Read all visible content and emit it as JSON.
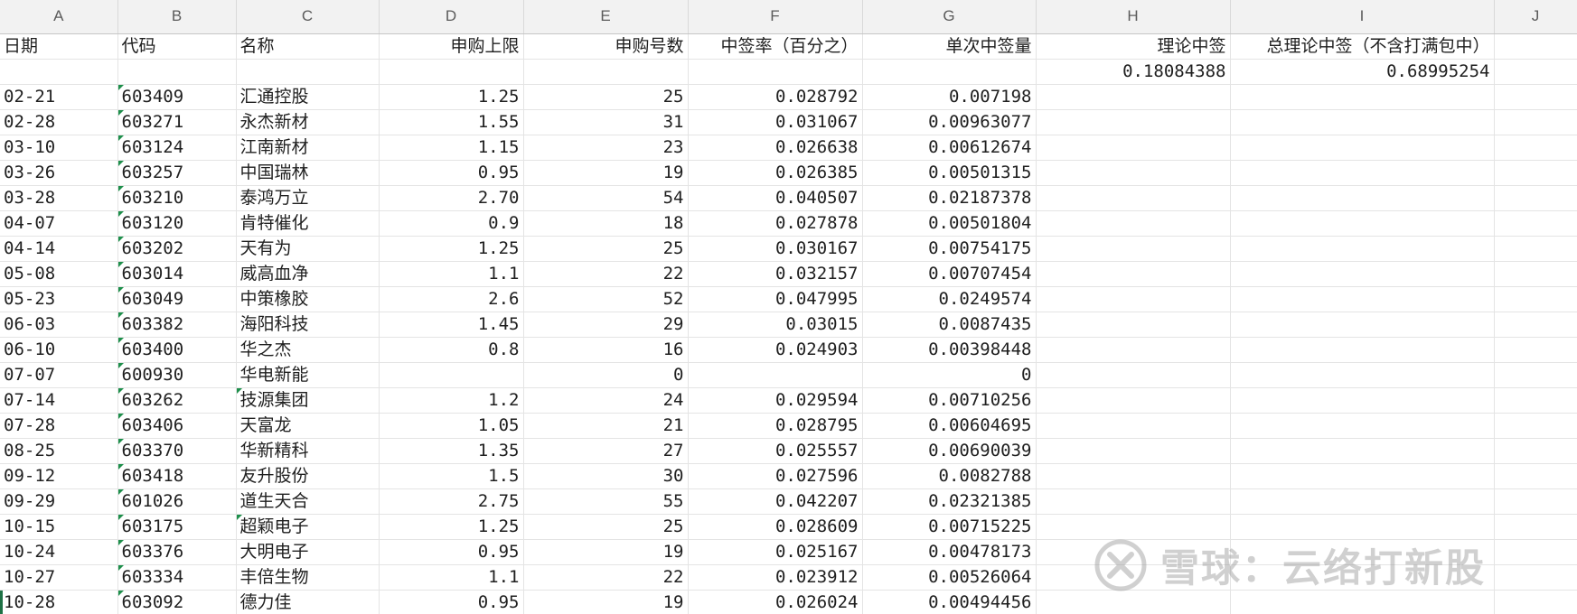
{
  "sheet": {
    "column_letters": [
      "A",
      "B",
      "C",
      "D",
      "E",
      "F",
      "G",
      "H",
      "I",
      "J"
    ],
    "headers": [
      "日期",
      "代码",
      "名称",
      "申购上限",
      "申购号数",
      "中签率（百分之）",
      "单次中签量",
      "理论中签",
      "总理论中签（不含打满包中）",
      ""
    ],
    "summary_row": [
      "",
      "",
      "",
      "",
      "",
      "",
      "",
      "0.18084388",
      "0.68995254",
      ""
    ],
    "rows": [
      [
        "02-21",
        "603409",
        "汇通控股",
        "1.25",
        "25",
        "0.028792",
        "0.007198",
        "",
        "",
        ""
      ],
      [
        "02-28",
        "603271",
        "永杰新材",
        "1.55",
        "31",
        "0.031067",
        "0.00963077",
        "",
        "",
        ""
      ],
      [
        "03-10",
        "603124",
        "江南新材",
        "1.15",
        "23",
        "0.026638",
        "0.00612674",
        "",
        "",
        ""
      ],
      [
        "03-26",
        "603257",
        "中国瑞林",
        "0.95",
        "19",
        "0.026385",
        "0.00501315",
        "",
        "",
        ""
      ],
      [
        "03-28",
        "603210",
        "泰鸿万立",
        "2.70",
        "54",
        "0.040507",
        "0.02187378",
        "",
        "",
        ""
      ],
      [
        "04-07",
        "603120",
        "肯特催化",
        "0.9",
        "18",
        "0.027878",
        "0.00501804",
        "",
        "",
        ""
      ],
      [
        "04-14",
        "603202",
        "天有为",
        "1.25",
        "25",
        "0.030167",
        "0.00754175",
        "",
        "",
        ""
      ],
      [
        "05-08",
        "603014",
        "威高血净",
        "1.1",
        "22",
        "0.032157",
        "0.00707454",
        "",
        "",
        ""
      ],
      [
        "05-23",
        "603049",
        "中策橡胶",
        "2.6",
        "52",
        "0.047995",
        "0.0249574",
        "",
        "",
        ""
      ],
      [
        "06-03",
        "603382",
        "海阳科技",
        "1.45",
        "29",
        "0.03015",
        "0.0087435",
        "",
        "",
        ""
      ],
      [
        "06-10",
        "603400",
        "华之杰",
        "0.8",
        "16",
        "0.024903",
        "0.00398448",
        "",
        "",
        ""
      ],
      [
        "07-07",
        "600930",
        "华电新能",
        "",
        "0",
        "",
        "0",
        "",
        "",
        ""
      ],
      [
        "07-14",
        "603262",
        "技源集团",
        "1.2",
        "24",
        "0.029594",
        "0.00710256",
        "",
        "",
        ""
      ],
      [
        "07-28",
        "603406",
        "天富龙",
        "1.05",
        "21",
        "0.028795",
        "0.00604695",
        "",
        "",
        ""
      ],
      [
        "08-25",
        "603370",
        "华新精科",
        "1.35",
        "27",
        "0.025557",
        "0.00690039",
        "",
        "",
        ""
      ],
      [
        "09-12",
        "603418",
        "友升股份",
        "1.5",
        "30",
        "0.027596",
        "0.0082788",
        "",
        "",
        ""
      ],
      [
        "09-29",
        "601026",
        "道生天合",
        "2.75",
        "55",
        "0.042207",
        "0.02321385",
        "",
        "",
        ""
      ],
      [
        "10-15",
        "603175",
        "超颖电子",
        "1.25",
        "25",
        "0.028609",
        "0.00715225",
        "",
        "",
        ""
      ],
      [
        "10-24",
        "603376",
        "大明电子",
        "0.95",
        "19",
        "0.025167",
        "0.00478173",
        "",
        "",
        ""
      ],
      [
        "10-27",
        "603334",
        "丰倍生物",
        "1.1",
        "22",
        "0.023912",
        "0.00526064",
        "",
        "",
        ""
      ],
      [
        "10-28",
        "603092",
        "德力佳",
        "0.95",
        "19",
        "0.026024",
        "0.00494456",
        "",
        "",
        ""
      ]
    ]
  },
  "watermark": {
    "text": "雪球：云络打新股",
    "icon": "xueqiu-logo"
  },
  "colors": {
    "header_bg": "#f2f2f2",
    "grid": "#e4e4e4",
    "text_number_flag": "#1e8f4b"
  }
}
